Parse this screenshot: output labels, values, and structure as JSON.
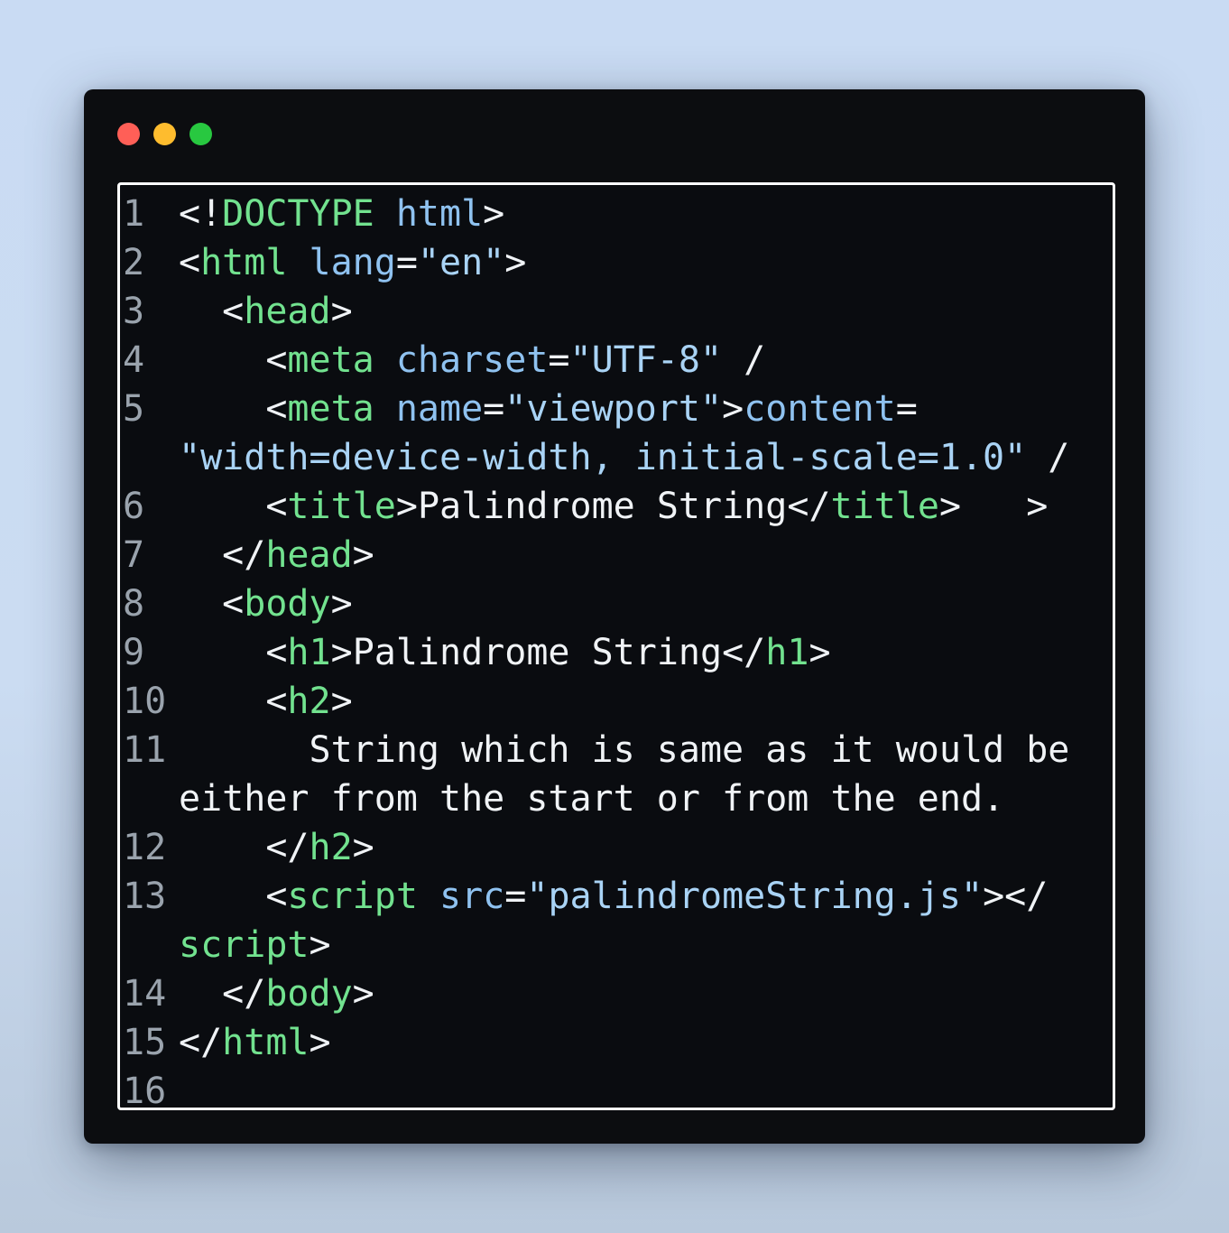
{
  "window_controls": {
    "close_color": "#ff5f57",
    "minimize_color": "#febc2e",
    "maximize_color": "#28c840"
  },
  "code": {
    "line_numbers": [
      "1",
      "2",
      "3",
      "4",
      "5",
      "6",
      "7",
      "8",
      "9",
      "10",
      "11",
      "12",
      "13",
      "14",
      "15",
      "16"
    ],
    "lines": [
      {
        "id": "l1",
        "tokens": [
          [
            "p",
            "<!"
          ],
          [
            "t",
            "DOCTYPE"
          ],
          [
            "x",
            " "
          ],
          [
            "a",
            "html"
          ],
          [
            "p",
            ">"
          ]
        ]
      },
      {
        "id": "l2",
        "tokens": [
          [
            "p",
            "<"
          ],
          [
            "t",
            "html"
          ],
          [
            "x",
            " "
          ],
          [
            "a",
            "lang"
          ],
          [
            "p",
            "="
          ],
          [
            "s",
            "\"en\""
          ],
          [
            "p",
            ">"
          ]
        ]
      },
      {
        "id": "l3",
        "tokens": [
          [
            "x",
            "  "
          ],
          [
            "p",
            "<"
          ],
          [
            "t",
            "head"
          ],
          [
            "p",
            ">"
          ]
        ]
      },
      {
        "id": "l4",
        "tokens": [
          [
            "x",
            "    "
          ],
          [
            "p",
            "<"
          ],
          [
            "t",
            "meta"
          ],
          [
            "x",
            " "
          ],
          [
            "a",
            "charset"
          ],
          [
            "p",
            "="
          ],
          [
            "s",
            "\"UTF-8\""
          ],
          [
            "x",
            " /"
          ]
        ]
      },
      {
        "id": "l5",
        "tokens": [
          [
            "x",
            "    "
          ],
          [
            "p",
            "<"
          ],
          [
            "t",
            "meta"
          ],
          [
            "x",
            " "
          ],
          [
            "a",
            "name"
          ],
          [
            "p",
            "="
          ],
          [
            "s",
            "\"viewport\""
          ],
          [
            "p",
            ">"
          ],
          [
            "a",
            "content"
          ],
          [
            "p",
            "="
          ]
        ]
      },
      {
        "id": "l5b",
        "tokens": [
          [
            "s",
            "\"width=device-width, initial-scale=1.0\""
          ],
          [
            "x",
            " /"
          ]
        ]
      },
      {
        "id": "l6",
        "tokens": [
          [
            "x",
            "    "
          ],
          [
            "p",
            "<"
          ],
          [
            "t",
            "title"
          ],
          [
            "p",
            ">"
          ],
          [
            "x",
            "Palindrome String"
          ],
          [
            "p",
            "</"
          ],
          [
            "t",
            "title"
          ],
          [
            "p",
            ">"
          ],
          [
            "x",
            "   >"
          ]
        ]
      },
      {
        "id": "l7",
        "tokens": [
          [
            "x",
            "  "
          ],
          [
            "p",
            "</"
          ],
          [
            "t",
            "head"
          ],
          [
            "p",
            ">"
          ]
        ]
      },
      {
        "id": "l8",
        "tokens": [
          [
            "x",
            "  "
          ],
          [
            "p",
            "<"
          ],
          [
            "t",
            "body"
          ],
          [
            "p",
            ">"
          ]
        ]
      },
      {
        "id": "l9",
        "tokens": [
          [
            "x",
            "    "
          ],
          [
            "p",
            "<"
          ],
          [
            "t",
            "h1"
          ],
          [
            "p",
            ">"
          ],
          [
            "x",
            "Palindrome String"
          ],
          [
            "p",
            "</"
          ],
          [
            "t",
            "h1"
          ],
          [
            "p",
            ">"
          ]
        ]
      },
      {
        "id": "l10",
        "tokens": [
          [
            "x",
            "    "
          ],
          [
            "p",
            "<"
          ],
          [
            "t",
            "h2"
          ],
          [
            "p",
            ">"
          ]
        ]
      },
      {
        "id": "l11",
        "tokens": [
          [
            "x",
            "      String which is same as it would be"
          ]
        ]
      },
      {
        "id": "l11b",
        "tokens": [
          [
            "x",
            "either from the start or from the end."
          ]
        ]
      },
      {
        "id": "l12",
        "tokens": [
          [
            "x",
            "    "
          ],
          [
            "p",
            "</"
          ],
          [
            "t",
            "h2"
          ],
          [
            "p",
            ">"
          ]
        ]
      },
      {
        "id": "l13",
        "tokens": [
          [
            "x",
            "    "
          ],
          [
            "p",
            "<"
          ],
          [
            "t",
            "script"
          ],
          [
            "x",
            " "
          ],
          [
            "a",
            "src"
          ],
          [
            "p",
            "="
          ],
          [
            "s",
            "\"palindromeString.js\""
          ],
          [
            "p",
            "></"
          ]
        ]
      },
      {
        "id": "l13b",
        "tokens": [
          [
            "t",
            "script"
          ],
          [
            "p",
            ">"
          ]
        ]
      },
      {
        "id": "l14",
        "tokens": [
          [
            "x",
            "  "
          ],
          [
            "p",
            "</"
          ],
          [
            "t",
            "body"
          ],
          [
            "p",
            ">"
          ]
        ]
      },
      {
        "id": "l15",
        "tokens": [
          [
            "p",
            "</"
          ],
          [
            "t",
            "html"
          ],
          [
            "p",
            ">"
          ]
        ]
      },
      {
        "id": "l16",
        "tokens": []
      }
    ]
  }
}
